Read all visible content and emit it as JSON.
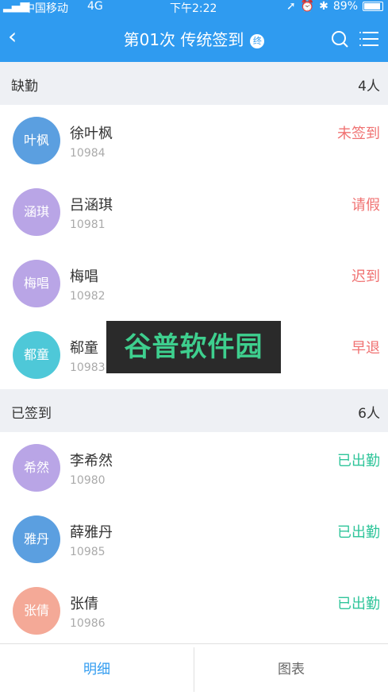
{
  "status_bar": {
    "carrier": "中国移动",
    "network": "4G",
    "time": "下午2:22",
    "battery": "89%",
    "battery_level": 0.89
  },
  "nav": {
    "title": "第01次 传统签到",
    "badge": "终"
  },
  "sections": [
    {
      "label": "缺勤",
      "count": "4人",
      "rows": [
        {
          "avatar_text": "叶枫",
          "avatar_color": "#5b9fe0",
          "name": "徐叶枫",
          "id": "10984",
          "status": "未签到",
          "status_color": "#f07272"
        },
        {
          "avatar_text": "涵琪",
          "avatar_color": "#b9a5e6",
          "name": "吕涵琪",
          "id": "10981",
          "status": "请假",
          "status_color": "#f07272"
        },
        {
          "avatar_text": "梅唱",
          "avatar_color": "#b9a5e6",
          "name": "梅唱",
          "id": "10982",
          "status": "迟到",
          "status_color": "#f07272"
        },
        {
          "avatar_text": "都童",
          "avatar_color": "#4ec8d8",
          "name": "郗童",
          "id": "10983",
          "status": "早退",
          "status_color": "#f07272"
        }
      ]
    },
    {
      "label": "已签到",
      "count": "6人",
      "rows": [
        {
          "avatar_text": "希然",
          "avatar_color": "#b9a5e6",
          "name": "李希然",
          "id": "10980",
          "status": "已出勤",
          "status_color": "#2fc59a"
        },
        {
          "avatar_text": "雅丹",
          "avatar_color": "#5b9fe0",
          "name": "薛雅丹",
          "id": "10985",
          "status": "已出勤",
          "status_color": "#2fc59a"
        },
        {
          "avatar_text": "张倩",
          "avatar_color": "#f4a997",
          "name": "张倩",
          "id": "10986",
          "status": "已出勤",
          "status_color": "#2fc59a"
        }
      ]
    }
  ],
  "watermark": "谷普软件园",
  "tabs": {
    "detail": "明细",
    "chart": "图表"
  }
}
